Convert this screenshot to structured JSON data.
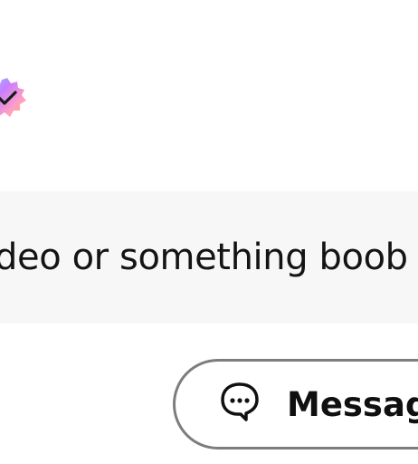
{
  "comment": {
    "text": "deo or something boob"
  },
  "message_button": {
    "label": "Message"
  },
  "badge": {
    "icon": "verified-check-icon",
    "gradient": [
      "#8ec5ff",
      "#c77dff",
      "#ff9ec7",
      "#ffb36b"
    ]
  },
  "colors": {
    "comment_background": "#f7f7f8",
    "button_border": "#7d7d7d",
    "text": "#141414"
  }
}
